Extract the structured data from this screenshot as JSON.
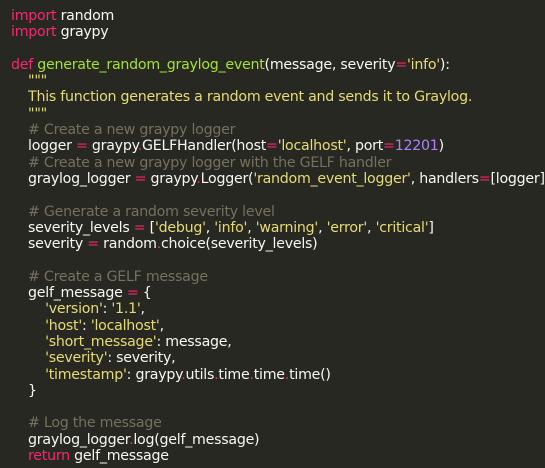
{
  "editor": {
    "title": "",
    "colors": {
      "background": "#272822",
      "text": "#f8f8f2",
      "keyword": "#f92672",
      "function": "#a6e22e",
      "string": "#e6db74",
      "number": "#ae81ff",
      "comment": "#75715e"
    },
    "lines": [
      [
        [
          "kw",
          "import"
        ],
        [
          "txt",
          " random"
        ]
      ],
      [
        [
          "kw",
          "import"
        ],
        [
          "txt",
          " graypy"
        ]
      ],
      [],
      [
        [
          "kw",
          "def"
        ],
        [
          "txt",
          " "
        ],
        [
          "fn",
          "generate_random_graylog_event"
        ],
        [
          "txt",
          "(message, severity"
        ],
        [
          "op",
          "="
        ],
        [
          "str",
          "'info'"
        ],
        [
          "txt",
          "):"
        ]
      ],
      [
        [
          "str",
          "    \"\"\""
        ]
      ],
      [
        [
          "str",
          "    This function generates a random event and sends it to Graylog."
        ]
      ],
      [
        [
          "str",
          "    \"\"\""
        ]
      ],
      [
        [
          "com",
          "    # Create a new graypy logger"
        ]
      ],
      [
        [
          "txt",
          "    logger "
        ],
        [
          "op",
          "="
        ],
        [
          "txt",
          " graypy"
        ],
        [
          "op",
          "."
        ],
        [
          "txt",
          "GELFHandler(host"
        ],
        [
          "op",
          "="
        ],
        [
          "str",
          "'localhost'"
        ],
        [
          "txt",
          ", port"
        ],
        [
          "op",
          "="
        ],
        [
          "num",
          "12201"
        ],
        [
          "txt",
          ")"
        ]
      ],
      [
        [
          "com",
          "    # Create a new graypy logger with the GELF handler"
        ]
      ],
      [
        [
          "txt",
          "    graylog_logger "
        ],
        [
          "op",
          "="
        ],
        [
          "txt",
          " graypy"
        ],
        [
          "op",
          "."
        ],
        [
          "txt",
          "Logger("
        ],
        [
          "str",
          "'random_event_logger'"
        ],
        [
          "txt",
          ", handlers"
        ],
        [
          "op",
          "="
        ],
        [
          "txt",
          "[logger])"
        ]
      ],
      [],
      [
        [
          "com",
          "    # Generate a random severity level"
        ]
      ],
      [
        [
          "txt",
          "    severity_levels "
        ],
        [
          "op",
          "="
        ],
        [
          "txt",
          " ["
        ],
        [
          "str",
          "'debug'"
        ],
        [
          "txt",
          ", "
        ],
        [
          "str",
          "'info'"
        ],
        [
          "txt",
          ", "
        ],
        [
          "str",
          "'warning'"
        ],
        [
          "txt",
          ", "
        ],
        [
          "str",
          "'error'"
        ],
        [
          "txt",
          ", "
        ],
        [
          "str",
          "'critical'"
        ],
        [
          "txt",
          "]"
        ]
      ],
      [
        [
          "txt",
          "    severity "
        ],
        [
          "op",
          "="
        ],
        [
          "txt",
          " random"
        ],
        [
          "op",
          "."
        ],
        [
          "txt",
          "choice(severity_levels)"
        ]
      ],
      [],
      [
        [
          "com",
          "    # Create a GELF message"
        ]
      ],
      [
        [
          "txt",
          "    gelf_message "
        ],
        [
          "op",
          "="
        ],
        [
          "txt",
          " {"
        ]
      ],
      [
        [
          "str",
          "        'version'"
        ],
        [
          "txt",
          ": "
        ],
        [
          "str",
          "'1.1'"
        ],
        [
          "txt",
          ","
        ]
      ],
      [
        [
          "str",
          "        'host'"
        ],
        [
          "txt",
          ": "
        ],
        [
          "str",
          "'localhost'"
        ],
        [
          "txt",
          ","
        ]
      ],
      [
        [
          "str",
          "        'short_message'"
        ],
        [
          "txt",
          ": message,"
        ]
      ],
      [
        [
          "str",
          "        'severity'"
        ],
        [
          "txt",
          ": severity,"
        ]
      ],
      [
        [
          "str",
          "        'timestamp'"
        ],
        [
          "txt",
          ": graypy"
        ],
        [
          "op",
          "."
        ],
        [
          "txt",
          "utils"
        ],
        [
          "op",
          "."
        ],
        [
          "txt",
          "time"
        ],
        [
          "op",
          "."
        ],
        [
          "txt",
          "time"
        ],
        [
          "op",
          "."
        ],
        [
          "txt",
          "time()"
        ]
      ],
      [
        [
          "txt",
          "    }"
        ]
      ],
      [],
      [
        [
          "com",
          "    # Log the message"
        ]
      ],
      [
        [
          "txt",
          "    graylog_logger"
        ],
        [
          "op",
          "."
        ],
        [
          "txt",
          "log(gelf_message)"
        ]
      ],
      [
        [
          "kw",
          "    return"
        ],
        [
          "txt",
          " gelf_message"
        ]
      ]
    ]
  }
}
